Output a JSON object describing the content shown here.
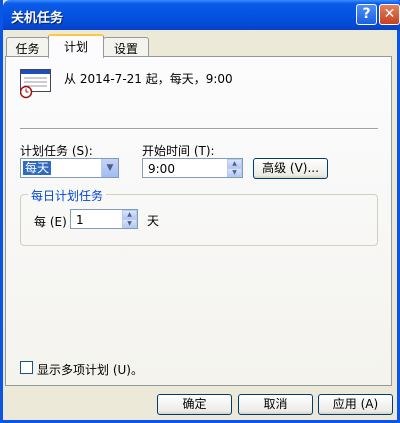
{
  "window": {
    "title": "关机任务",
    "help_glyph": "?",
    "close_glyph": "✕"
  },
  "tabs": [
    {
      "label": "任务"
    },
    {
      "label": "计划"
    },
    {
      "label": "设置"
    }
  ],
  "summary": "从 2014-7-21 起，每天，9:00",
  "schedule": {
    "task_label": "计划任务 (S):",
    "task_value": "每天",
    "start_label": "开始时间 (T):",
    "start_value": "9:00",
    "advanced_label": "高级 (V)..."
  },
  "daily": {
    "group_title": "每日计划任务",
    "every_label": "每 (E)",
    "every_value": "1",
    "unit": "天"
  },
  "multi": {
    "label": "显示多项计划 (U)。"
  },
  "footer": {
    "ok": "确定",
    "cancel": "取消",
    "apply": "应用 (A)"
  }
}
